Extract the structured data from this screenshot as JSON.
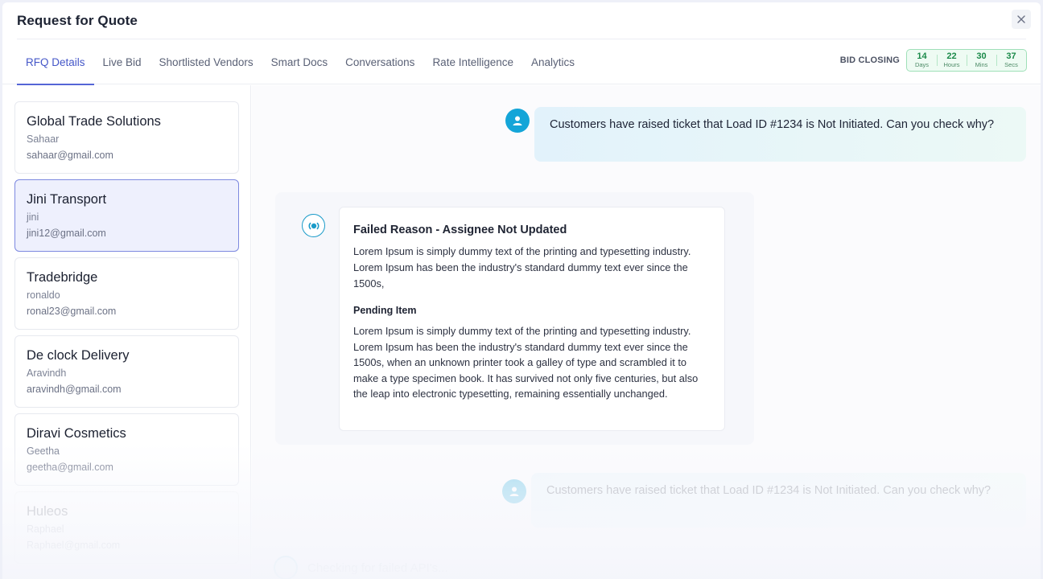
{
  "header": {
    "title": "Request for Quote"
  },
  "tabs": [
    {
      "label": "RFQ Details",
      "active": true
    },
    {
      "label": "Live Bid"
    },
    {
      "label": "Shortlisted Vendors"
    },
    {
      "label": "Smart Docs"
    },
    {
      "label": "Conversations"
    },
    {
      "label": "Rate Intelligence"
    },
    {
      "label": "Analytics"
    }
  ],
  "bid_closing": {
    "label": "BID CLOSING",
    "days": "14",
    "days_unit": "Days",
    "hours": "22",
    "hours_unit": "Hours",
    "mins": "30",
    "mins_unit": "Mins",
    "secs": "37",
    "secs_unit": "Secs"
  },
  "vendors": [
    {
      "name": "Global Trade Solutions",
      "contact": "Sahaar",
      "email": "sahaar@gmail.com"
    },
    {
      "name": "Jini Transport",
      "contact": "jini",
      "email": "jini12@gmail.com",
      "selected": true
    },
    {
      "name": "Tradebridge",
      "contact": "ronaldo",
      "email": "ronal23@gmail.com"
    },
    {
      "name": "De clock Delivery",
      "contact": "Aravindh",
      "email": "aravindh@gmail.com"
    },
    {
      "name": "Diravi Cosmetics",
      "contact": "Geetha",
      "email": "geetha@gmail.com"
    },
    {
      "name": "Huleos",
      "contact": "Raphael",
      "email": "Raphael@gmail.com"
    }
  ],
  "chat": {
    "user_message_1": "Customers have raised ticket that Load ID #1234 is Not Initiated. Can you check why?",
    "bot": {
      "title": "Failed Reason - Assignee Not Updated",
      "text": "Lorem Ipsum is simply dummy text of the printing and typesetting industry. Lorem Ipsum has been the industry's standard dummy text ever since the 1500s,",
      "subtitle": "Pending Item",
      "text2": "Lorem Ipsum is simply dummy text of the printing and typesetting industry. Lorem Ipsum has been the industry's standard dummy text ever since the 1500s, when an unknown printer took a galley of type and scrambled it to make a type specimen book. It has survived not only five centuries, but also the leap into electronic typesetting, remaining essentially unchanged."
    },
    "user_message_2": "Customers have raised ticket that Load ID #1234 is Not Initiated. Can you check why?",
    "status": "Checking for failed API's..."
  },
  "colors": {
    "accent": "#5565d6",
    "timer_green": "#1b8a4a",
    "avatar": "#14a5d8"
  }
}
